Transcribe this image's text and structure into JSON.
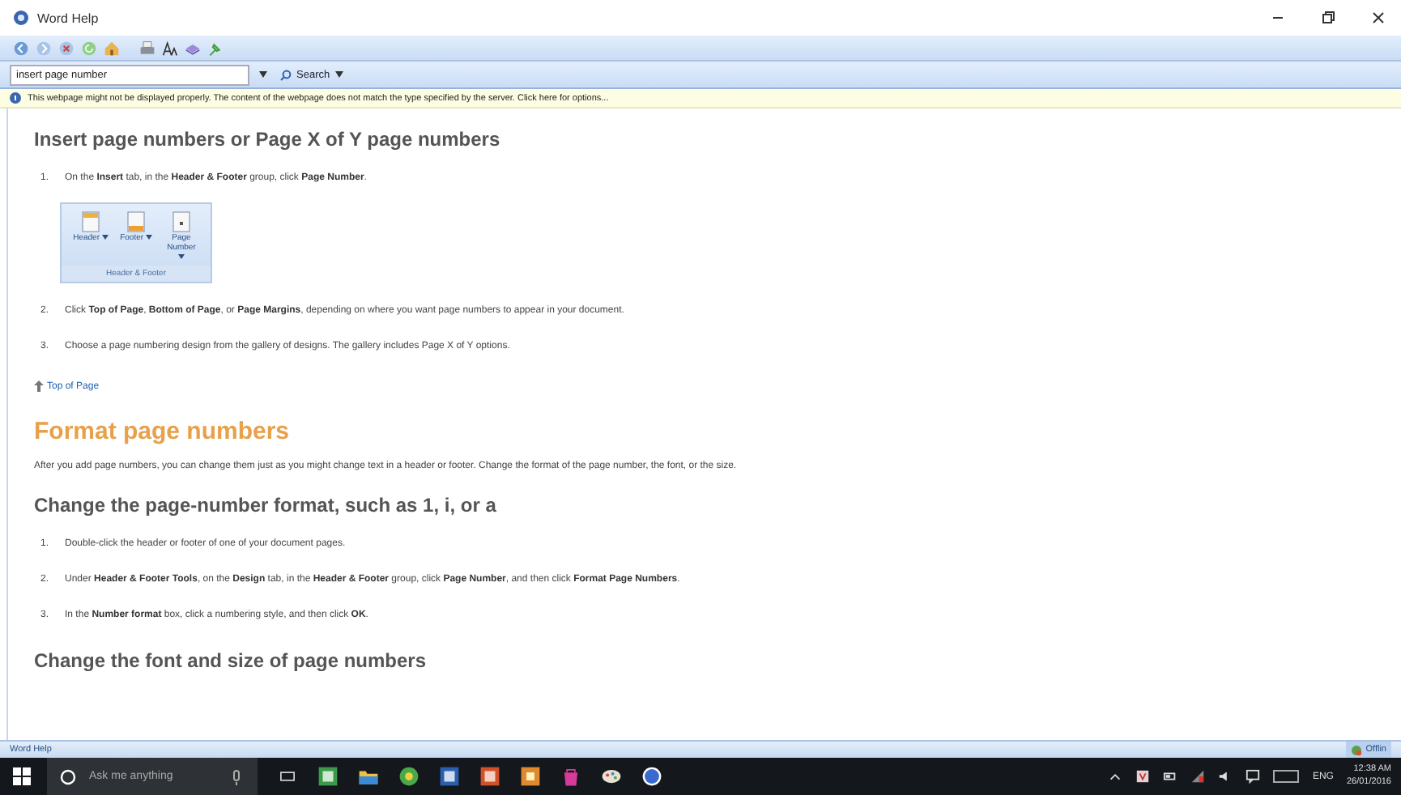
{
  "window": {
    "title": "Word Help"
  },
  "search": {
    "value": "insert page number",
    "button": "Search"
  },
  "info_bar": {
    "text": "This webpage might not be displayed properly.  The content of the webpage does not match the type specified by the server.  Click here for options..."
  },
  "content": [
    {
      "kind": "heading",
      "text": "Insert page numbers or Page X of Y page numbers"
    },
    {
      "kind": "step",
      "number": "1.",
      "text": "On the **Insert** tab, in the **Header & Footer** group, click **Page Number**."
    },
    {
      "kind": "ribbon",
      "buttons": [
        {
          "label": "Header"
        },
        {
          "label": "Footer"
        },
        {
          "label": "Page Number"
        }
      ],
      "group": "Header & Footer"
    },
    {
      "kind": "step",
      "number": "2.",
      "text": "Click **Top of Page**, **Bottom of Page**, or **Page Margins**, depending on where you want page numbers to appear in your document."
    },
    {
      "kind": "step",
      "number": "3.",
      "text": "Choose a page numbering design from the gallery of designs. The gallery includes Page X of Y options."
    },
    {
      "kind": "link",
      "text": "Top of Page"
    },
    {
      "kind": "title",
      "text": "Format page numbers"
    },
    {
      "kind": "paragraph",
      "text": "After you add page numbers, you can change them just as you might change text in a header or footer. Change the format of the page number, the font, or the size."
    },
    {
      "kind": "heading",
      "text": "Change the page-number format, such as 1, i, or a"
    },
    {
      "kind": "step",
      "number": "1.",
      "text": "Double-click the header or footer of one of your document pages."
    },
    {
      "kind": "step",
      "number": "2.",
      "text": "Under **Header & Footer Tools**, on the **Design** tab, in the **Header & Footer** group, click **Page Number**, and then click **Format Page Numbers**."
    },
    {
      "kind": "step",
      "number": "3.",
      "text": "In the **Number format** box, click a numbering style, and then click **OK**."
    },
    {
      "kind": "heading",
      "text": "Change the font and size of page numbers"
    }
  ],
  "status_bar": {
    "text": "Word Help",
    "status": "Offlin"
  },
  "taskbar": {
    "search_placeholder": "Ask me anything",
    "language": "ENG",
    "time": "12:38 AM",
    "date": "26/01/2016"
  }
}
